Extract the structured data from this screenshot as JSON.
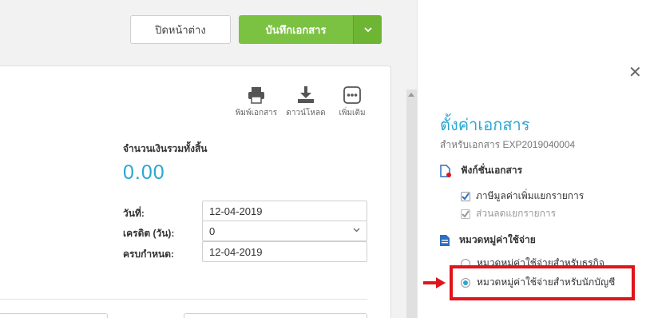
{
  "header": {
    "close_window_label": "ปิดหน้าต่าง",
    "save_label": "บันทึกเอกสาร"
  },
  "toolbar": {
    "print_label": "พิมพ์เอกสาร",
    "download_label": "ดาวน์โหลด",
    "more_label": "เพิ่มเติม"
  },
  "document": {
    "total_label": "จำนวนเงินรวมทั้งสิ้น",
    "total_value": "0.00",
    "date_label": "วันที่:",
    "date_value": "12-04-2019",
    "credit_label": "เครดิต (วัน):",
    "credit_value": "0",
    "due_label": "ครบกำหนด:",
    "due_value": "12-04-2019"
  },
  "settings_panel": {
    "title": "ตั้งค่าเอกสาร",
    "subtitle": "สำหรับเอกสาร EXP2019040004",
    "functions_heading": "ฟังก์ชั่นเอกสาร",
    "options": [
      {
        "label": "ภาษีมูลค่าเพิ่มแยกรายการ",
        "checked": true,
        "disabled": false
      },
      {
        "label": "ส่วนลดแยกรายการ",
        "checked": true,
        "disabled": true
      }
    ],
    "category_heading": "หมวดหมู่ค่าใช้จ่าย",
    "categories": [
      {
        "label": "หมวดหมู่ค่าใช้จ่ายสำหรับธุรกิจ",
        "selected": false
      },
      {
        "label": "หมวดหมู่ค่าใช้จ่ายสำหรับนักบัญชี",
        "selected": true
      }
    ]
  },
  "colors": {
    "accent": "#2aa7d0",
    "save_green": "#7cc242",
    "highlight_red": "#e0141b"
  }
}
